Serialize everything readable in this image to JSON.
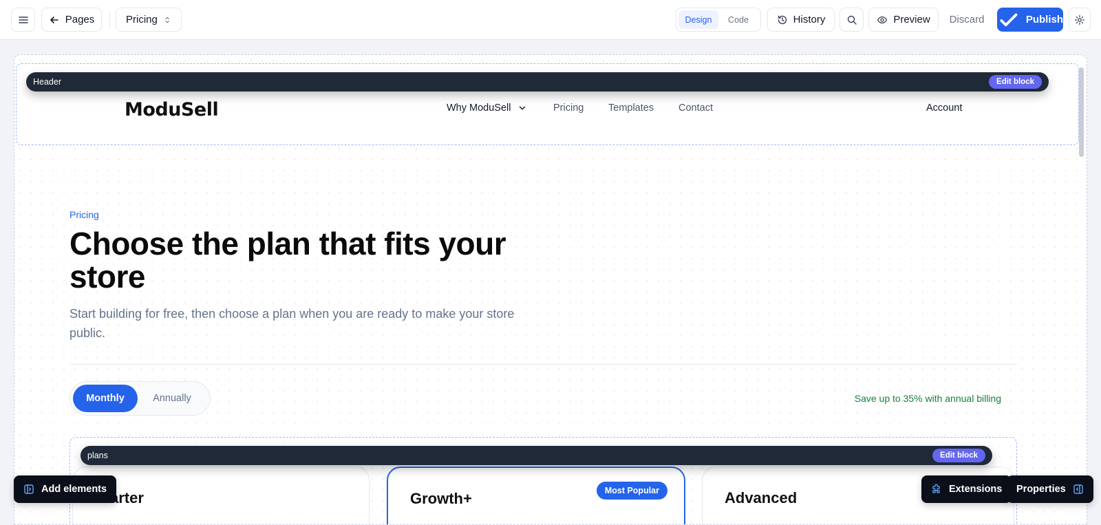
{
  "toolbar": {
    "back_label": "Pages",
    "page_select": "Pricing",
    "mode_design": "Design",
    "mode_code": "Code",
    "history_label": "History",
    "preview_label": "Preview",
    "discard_label": "Discard",
    "publish_label": "Publish",
    "accent": "#2563eb"
  },
  "header_block": {
    "label": "Header",
    "edit_label": "Edit block"
  },
  "site": {
    "logo": "ModuSell",
    "nav": [
      {
        "label": "Why ModuSell",
        "has_dropdown": true
      },
      {
        "label": "Pricing"
      },
      {
        "label": "Templates"
      },
      {
        "label": "Contact"
      }
    ],
    "account": "Account"
  },
  "hero": {
    "eyebrow": "Pricing",
    "title": "Choose the plan that fits your store",
    "subtitle": "Start building for free, then choose a plan when you are ready to make your store public."
  },
  "billing": {
    "monthly": "Monthly",
    "annually": "Annually",
    "selected": "Monthly",
    "save_note": "Save up to 35% with annual billing",
    "save_color": "#15803d"
  },
  "plans_block": {
    "label": "plans",
    "edit_label": "Edit block",
    "plans": [
      {
        "name": "Starter"
      },
      {
        "name": "Growth+",
        "badge": "Most Popular"
      },
      {
        "name": "Advanced"
      }
    ]
  },
  "fabs": {
    "add_elements": "Add elements",
    "extensions": "Extensions",
    "properties": "Properties"
  }
}
